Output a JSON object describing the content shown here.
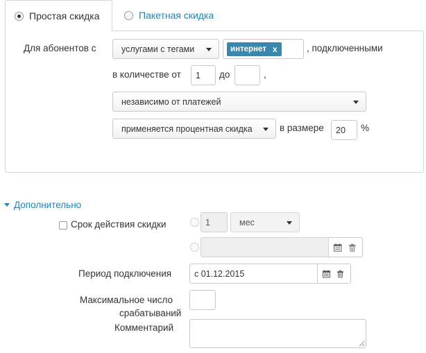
{
  "tabs": [
    {
      "label": "Простая скидка",
      "selected": true
    },
    {
      "label": "Пакетная скидка",
      "selected": false
    }
  ],
  "rule": {
    "for_subscribers_label": "Для абонентов с",
    "service_select": "услугами с тегами",
    "tag": "интернет",
    "tag_remove": "x",
    "connected_label": ", подключенными",
    "quantity_from_label": "в количестве от",
    "quantity_from": "1",
    "quantity_to_label": "до",
    "quantity_to": "",
    "comma": ",",
    "payments_select": "независимо от платежей",
    "discount_type_select": "применяется процентная скидка",
    "size_label": "в размере",
    "size_value": "20",
    "percent_sign": "%"
  },
  "additional": {
    "toggle_label": "Дополнительно",
    "validity_label": "Срок действия скидки",
    "validity_amount": "1",
    "validity_unit": "мес",
    "validity_date": "",
    "connection_period_label": "Период подключения",
    "connection_period_value": "с 01.12.2015",
    "max_triggers_label_line1": "Максимальное число",
    "max_triggers_label_line2": "срабатываний",
    "max_triggers_value": "",
    "comment_label": "Комментарий",
    "comment_value": ""
  },
  "colors": {
    "link": "#1a84c7",
    "tag_bg": "#3a87ad",
    "border": "#c8c8c8"
  },
  "icons": [
    "calendar-icon",
    "trash-icon",
    "caret-down-icon",
    "triangle-down-icon",
    "resize-handle-icon"
  ]
}
